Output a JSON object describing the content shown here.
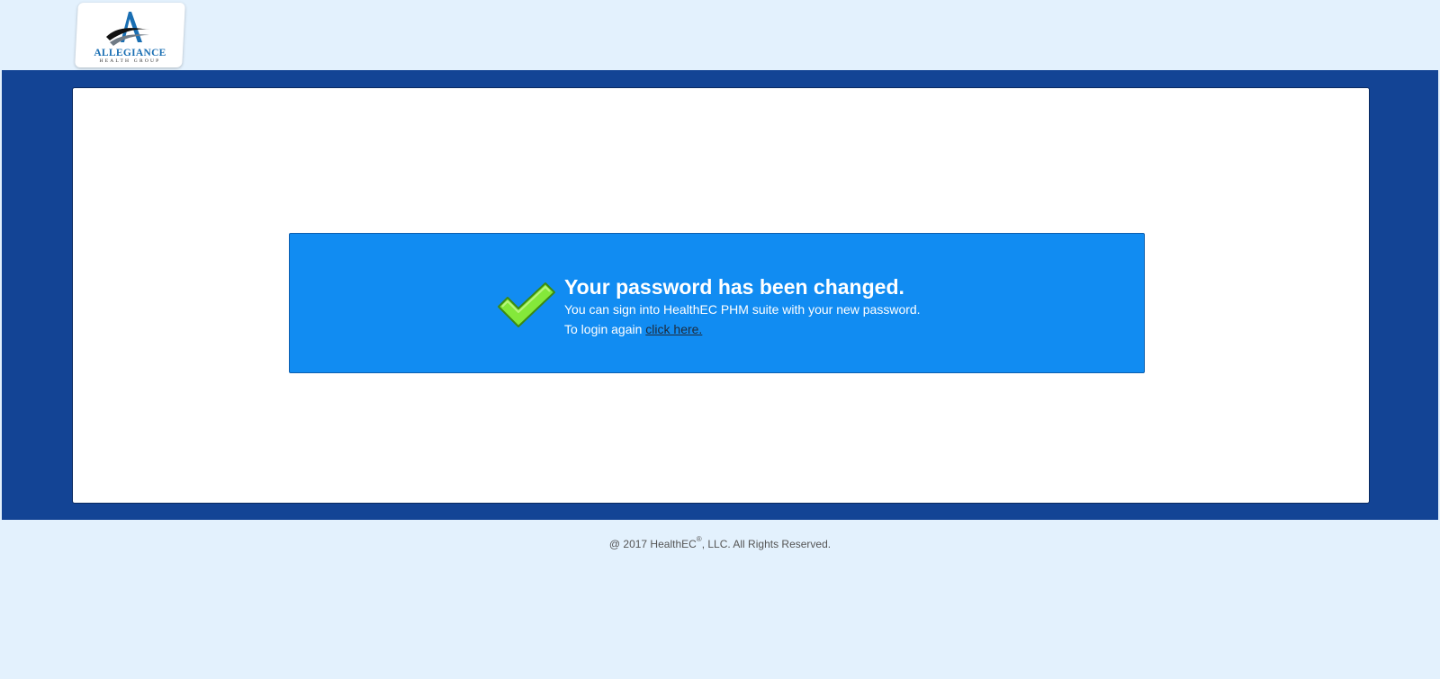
{
  "logo": {
    "name": "ALLEGIANCE",
    "subtitle": "HEALTH GROUP",
    "icon": "allegiance-a-logo-icon"
  },
  "message": {
    "icon": "green-checkmark-icon",
    "title": "Your password has been changed.",
    "line1": "You can sign into HealthEC PHM suite with your new password.",
    "login_prefix": "To login again ",
    "login_link": "click here."
  },
  "footer": {
    "prefix": "@ 2017 HealthEC",
    "registered": "®",
    "suffix": ", LLC. All Rights Reserved."
  },
  "colors": {
    "page_background": "#e3f1fd",
    "band": "#134495",
    "alert": "#118cf2",
    "check": "#84e83a"
  }
}
